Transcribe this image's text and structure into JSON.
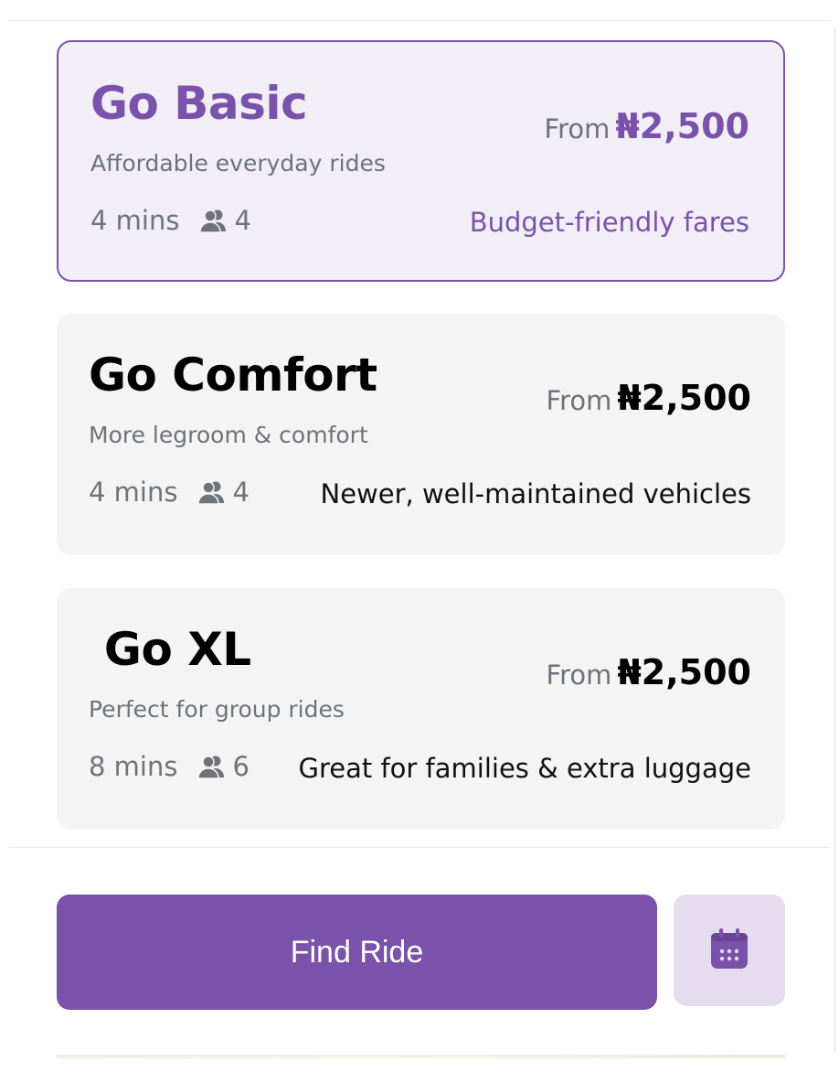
{
  "colors": {
    "accent": "#7a52a9",
    "accent_light": "#e6dcef",
    "selected_bg": "#f1eef5",
    "card_bg": "#f4f4f4",
    "muted_text": "#6e7378"
  },
  "rides": [
    {
      "title": "Go Basic",
      "subtitle": "Affordable everyday rides",
      "price_prefix": "From",
      "price": "₦2,500",
      "eta": "4 mins",
      "seats": "4",
      "feature": "Budget-friendly fares",
      "selected": true
    },
    {
      "title": "Go Comfort",
      "subtitle": "More legroom & comfort",
      "price_prefix": "From",
      "price": "₦2,500",
      "eta": "4 mins",
      "seats": "4",
      "feature": "Newer, well-maintained vehicles",
      "selected": false
    },
    {
      "title": " Go XL",
      "subtitle": "Perfect for group rides",
      "price_prefix": "From",
      "price": "₦2,500",
      "eta": "8 mins",
      "seats": "6",
      "feature": "Great for families & extra luggage",
      "selected": false
    }
  ],
  "actions": {
    "find_ride_label": "Find Ride",
    "schedule_icon": "calendar-icon"
  }
}
